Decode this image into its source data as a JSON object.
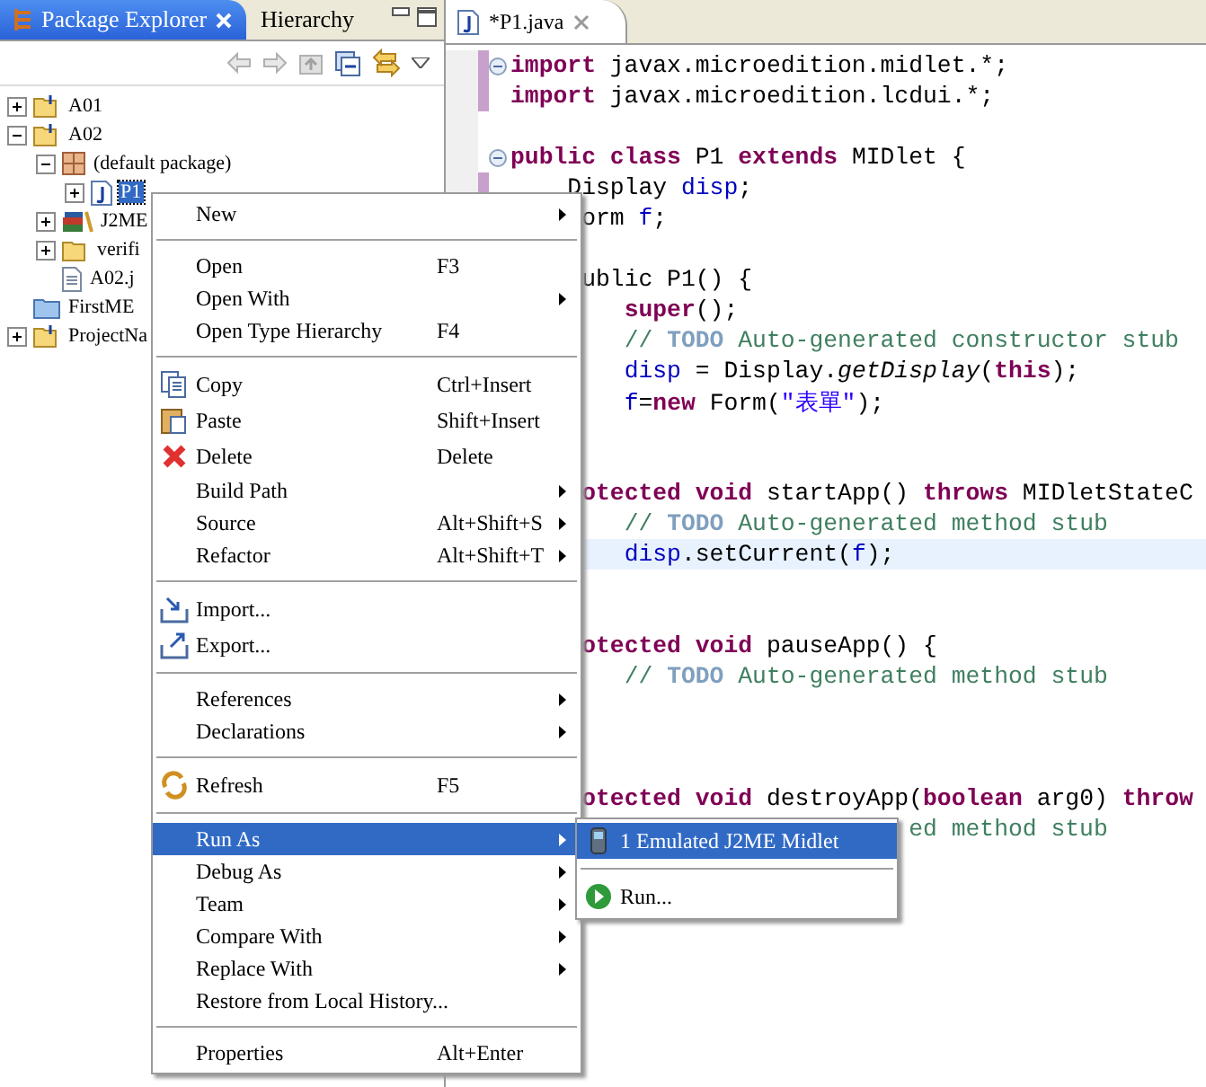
{
  "explorer": {
    "tabs": [
      {
        "label": "Package Explorer",
        "selected": true
      },
      {
        "label": "Hierarchy",
        "selected": false
      }
    ],
    "tree": [
      {
        "label": "A01",
        "kind": "project",
        "expanded": false,
        "selected": false
      },
      {
        "label": "A02",
        "kind": "project",
        "expanded": true,
        "selected": false,
        "children": [
          {
            "label": "(default package)",
            "kind": "package",
            "expanded": true,
            "selected": false,
            "children": [
              {
                "label": "P1",
                "kind": "java",
                "expanded": false,
                "selected": true
              }
            ]
          },
          {
            "label": "J2ME",
            "kind": "library",
            "expanded": false,
            "selected": false
          },
          {
            "label": "verifi",
            "kind": "folder",
            "expanded": false,
            "selected": false
          },
          {
            "label": "A02.j",
            "kind": "file",
            "selected": false
          }
        ]
      },
      {
        "label": "FirstME",
        "kind": "closed-project",
        "selected": false
      },
      {
        "label": "ProjectNa",
        "kind": "project",
        "expanded": false,
        "selected": false
      }
    ]
  },
  "editor": {
    "tab": {
      "label": "*P1.java"
    },
    "lines": [
      {
        "kind": "code",
        "changed": true,
        "fold": true,
        "tokens": [
          {
            "kind": "kw",
            "text": "import"
          },
          {
            "kind": "plain",
            "text": " javax.microedition.midlet.*;"
          }
        ]
      },
      {
        "kind": "code",
        "changed": true,
        "tokens": [
          {
            "kind": "kw",
            "text": "import"
          },
          {
            "kind": "plain",
            "text": " javax.microedition.lcdui.*;"
          }
        ]
      },
      {
        "kind": "blank"
      },
      {
        "kind": "code",
        "fold": true,
        "tokens": [
          {
            "kind": "kw",
            "text": "public class"
          },
          {
            "kind": "plain",
            "text": " P1 "
          },
          {
            "kind": "kw",
            "text": "extends"
          },
          {
            "kind": "plain",
            "text": " MIDlet {"
          }
        ]
      },
      {
        "kind": "code",
        "changed": true,
        "tokens": [
          {
            "kind": "plain",
            "text": "    Display "
          },
          {
            "kind": "field",
            "text": "disp"
          },
          {
            "kind": "plain",
            "text": ";"
          }
        ]
      },
      {
        "kind": "code",
        "tokens": [
          {
            "kind": "plain",
            "text": "     orm "
          },
          {
            "kind": "field",
            "text": "f"
          },
          {
            "kind": "plain",
            "text": ";"
          }
        ]
      },
      {
        "kind": "blank"
      },
      {
        "kind": "code",
        "tokens": [
          {
            "kind": "plain",
            "text": "     ublic P1() {"
          }
        ]
      },
      {
        "kind": "code",
        "tokens": [
          {
            "kind": "kw",
            "text": "        super"
          },
          {
            "kind": "plain",
            "text": "();"
          }
        ]
      },
      {
        "kind": "code",
        "tokens": [
          {
            "kind": "comment",
            "text": "        // "
          },
          {
            "kind": "todo",
            "text": "TODO"
          },
          {
            "kind": "comment",
            "text": " Auto-generated constructor stub"
          }
        ]
      },
      {
        "kind": "code",
        "tokens": [
          {
            "kind": "field",
            "text": "        disp"
          },
          {
            "kind": "plain",
            "text": " = Display."
          },
          {
            "kind": "italic",
            "text": "getDisplay"
          },
          {
            "kind": "plain",
            "text": "("
          },
          {
            "kind": "kw",
            "text": "this"
          },
          {
            "kind": "plain",
            "text": ");"
          }
        ]
      },
      {
        "kind": "code",
        "tokens": [
          {
            "kind": "field",
            "text": "        f"
          },
          {
            "kind": "plain",
            "text": "="
          },
          {
            "kind": "kw",
            "text": "new"
          },
          {
            "kind": "plain",
            "text": " Form("
          },
          {
            "kind": "str",
            "text": "\"表單\""
          },
          {
            "kind": "plain",
            "text": ");"
          }
        ]
      },
      {
        "kind": "blank"
      },
      {
        "kind": "blank"
      },
      {
        "kind": "code",
        "tokens": [
          {
            "kind": "kw",
            "text": "     otected void"
          },
          {
            "kind": "plain",
            "text": " startApp() "
          },
          {
            "kind": "kw",
            "text": "throws"
          },
          {
            "kind": "plain",
            "text": " MIDletStateC"
          }
        ]
      },
      {
        "kind": "code",
        "tokens": [
          {
            "kind": "comment",
            "text": "        // "
          },
          {
            "kind": "todo",
            "text": "TODO"
          },
          {
            "kind": "comment",
            "text": " Auto-generated method stub"
          }
        ]
      },
      {
        "kind": "code",
        "highlighted": true,
        "tokens": [
          {
            "kind": "field",
            "text": "        disp"
          },
          {
            "kind": "plain",
            "text": ".setCurrent("
          },
          {
            "kind": "field",
            "text": "f"
          },
          {
            "kind": "plain",
            "text": ");"
          }
        ]
      },
      {
        "kind": "blank"
      },
      {
        "kind": "blank"
      },
      {
        "kind": "code",
        "tokens": [
          {
            "kind": "kw",
            "text": "     otected void"
          },
          {
            "kind": "plain",
            "text": " pauseApp() {"
          }
        ]
      },
      {
        "kind": "code",
        "tokens": [
          {
            "kind": "comment",
            "text": "        // "
          },
          {
            "kind": "todo",
            "text": "TODO"
          },
          {
            "kind": "comment",
            "text": " Auto-generated method stub"
          }
        ]
      },
      {
        "kind": "blank"
      },
      {
        "kind": "blank"
      },
      {
        "kind": "blank"
      },
      {
        "kind": "code",
        "tokens": [
          {
            "kind": "kw",
            "text": "     otected void"
          },
          {
            "kind": "plain",
            "text": " destroyApp("
          },
          {
            "kind": "kw",
            "text": "boolean"
          },
          {
            "kind": "plain",
            "text": " arg0) "
          },
          {
            "kind": "kw",
            "text": "throw"
          }
        ]
      },
      {
        "kind": "code",
        "tokens": [
          {
            "kind": "comment",
            "text": "                            ed method stub"
          }
        ]
      }
    ]
  },
  "context_menu": [
    {
      "kind": "item",
      "label": "New",
      "submenu": true,
      "selected": false
    },
    {
      "kind": "separator"
    },
    {
      "kind": "item",
      "label": "Open",
      "shortcut": "F3",
      "selected": false
    },
    {
      "kind": "item",
      "label": "Open With",
      "submenu": true,
      "selected": false
    },
    {
      "kind": "item",
      "label": "Open Type Hierarchy",
      "shortcut": "F4",
      "selected": false
    },
    {
      "kind": "separator"
    },
    {
      "kind": "item",
      "label": "Copy",
      "shortcut": "Ctrl+Insert",
      "selected": false
    },
    {
      "kind": "item",
      "label": "Paste",
      "shortcut": "Shift+Insert",
      "selected": false
    },
    {
      "kind": "item",
      "label": "Delete",
      "shortcut": "Delete",
      "selected": false
    },
    {
      "kind": "item",
      "label": "Build Path",
      "submenu": true,
      "selected": false
    },
    {
      "kind": "item",
      "label": "Source",
      "shortcut": "Alt+Shift+S",
      "submenu": true,
      "selected": false
    },
    {
      "kind": "item",
      "label": "Refactor",
      "shortcut": "Alt+Shift+T",
      "submenu": true,
      "selected": false
    },
    {
      "kind": "separator"
    },
    {
      "kind": "item",
      "label": "Import...",
      "selected": false
    },
    {
      "kind": "item",
      "label": "Export...",
      "selected": false
    },
    {
      "kind": "separator"
    },
    {
      "kind": "item",
      "label": "References",
      "submenu": true,
      "selected": false
    },
    {
      "kind": "item",
      "label": "Declarations",
      "submenu": true,
      "selected": false
    },
    {
      "kind": "separator"
    },
    {
      "kind": "item",
      "label": "Refresh",
      "shortcut": "F5",
      "selected": false
    },
    {
      "kind": "separator"
    },
    {
      "kind": "item",
      "label": "Run As",
      "submenu": true,
      "selected": true
    },
    {
      "kind": "item",
      "label": "Debug As",
      "submenu": true,
      "selected": false
    },
    {
      "kind": "item",
      "label": "Team",
      "submenu": true,
      "selected": false
    },
    {
      "kind": "item",
      "label": "Compare With",
      "submenu": true,
      "selected": false
    },
    {
      "kind": "item",
      "label": "Replace With",
      "submenu": true,
      "selected": false
    },
    {
      "kind": "item",
      "label": "Restore from Local History...",
      "selected": false
    },
    {
      "kind": "separator"
    },
    {
      "kind": "item",
      "label": "Properties",
      "shortcut": "Alt+Enter",
      "selected": false
    }
  ],
  "submenu": [
    {
      "kind": "item",
      "label": "1 Emulated J2ME Midlet",
      "selected": true
    },
    {
      "kind": "separator"
    },
    {
      "kind": "item",
      "label": "Run...",
      "selected": false
    }
  ]
}
